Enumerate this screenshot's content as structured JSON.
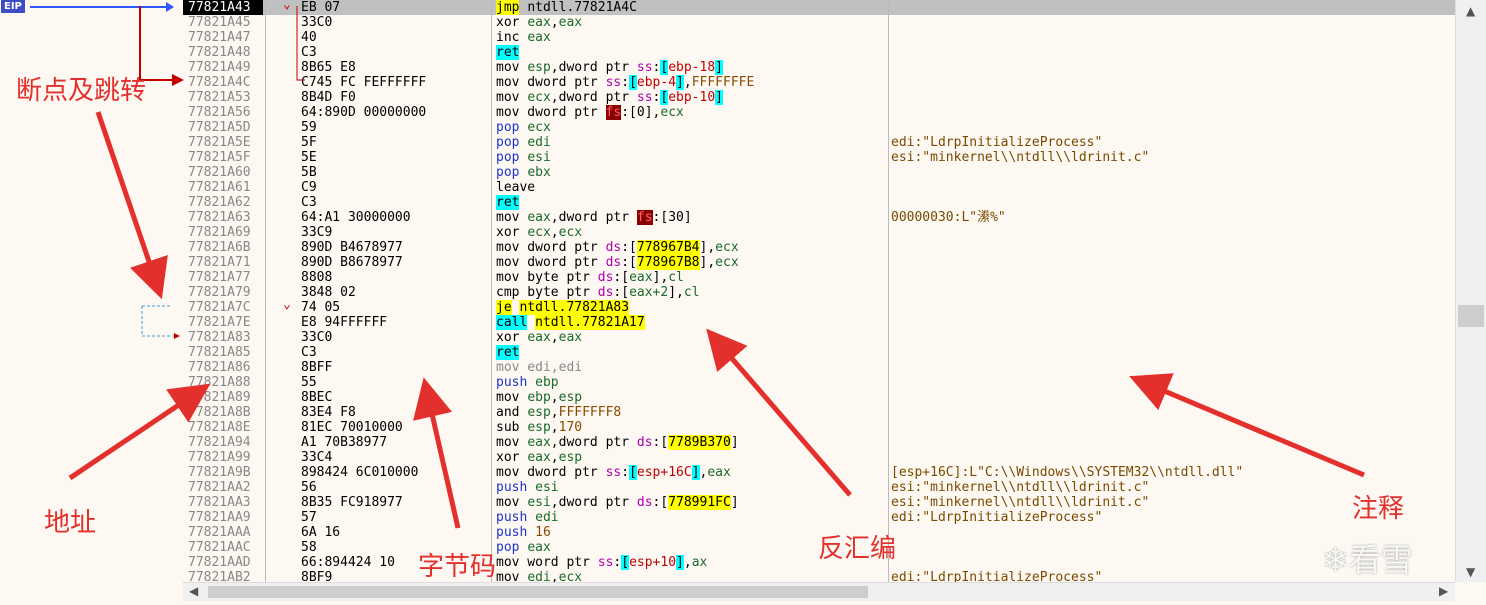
{
  "eip_label": "EIP",
  "colors": {
    "accent": "#3d4dc4",
    "annotation": "#e3302d",
    "highlight_yellow": "#ffff00",
    "highlight_cyan": "#00ffff"
  },
  "rows": [
    {
      "addr": "77821A43",
      "bytes": "EB 07",
      "asm": [
        [
          "jmp",
          "hl-y"
        ],
        [
          " ",
          ""
        ],
        [
          "ntdll.7782",
          ""
        ],
        [
          "1A4C",
          ""
        ]
      ],
      "cmt": "",
      "sel": true,
      "jmp": "v"
    },
    {
      "addr": "77821A45",
      "bytes": "33C0",
      "asm": [
        [
          "xor",
          ""
        ],
        [
          " ",
          ""
        ],
        [
          "eax",
          "reg"
        ],
        [
          ",",
          ""
        ],
        [
          "eax",
          "reg"
        ]
      ],
      "cmt": ""
    },
    {
      "addr": "77821A47",
      "bytes": "40",
      "asm": [
        [
          "inc",
          ""
        ],
        [
          " ",
          ""
        ],
        [
          "eax",
          "reg"
        ]
      ],
      "cmt": ""
    },
    {
      "addr": "77821A48",
      "bytes": "C3",
      "asm": [
        [
          "ret",
          "hl-c"
        ]
      ],
      "cmt": ""
    },
    {
      "addr": "77821A49",
      "bytes": "8B65 E8",
      "asm": [
        [
          "mov",
          ""
        ],
        [
          " ",
          ""
        ],
        [
          "esp",
          "reg"
        ],
        [
          ",dword ptr ",
          ""
        ],
        [
          "ss",
          "seg"
        ],
        [
          ":",
          ""
        ],
        [
          "[",
          "hl-c"
        ],
        [
          "ebp-18",
          "red"
        ],
        [
          "]",
          "hl-c"
        ]
      ],
      "cmt": ""
    },
    {
      "addr": "77821A4C",
      "bytes": "C745 FC FEFFFFFF",
      "asm": [
        [
          "mov",
          ""
        ],
        [
          " dword ptr ",
          ""
        ],
        [
          "ss",
          "seg"
        ],
        [
          ":",
          ""
        ],
        [
          "[",
          "hl-c"
        ],
        [
          "ebp-4",
          "red"
        ],
        [
          "]",
          "hl-c"
        ],
        [
          ",",
          ""
        ],
        [
          "FFFFFFFE",
          "num"
        ]
      ],
      "cmt": ""
    },
    {
      "addr": "77821A53",
      "bytes": "8B4D F0",
      "asm": [
        [
          "mov",
          ""
        ],
        [
          " ",
          ""
        ],
        [
          "ecx",
          "reg"
        ],
        [
          ",dword ptr ",
          ""
        ],
        [
          "ss",
          "seg"
        ],
        [
          ":",
          ""
        ],
        [
          "[",
          "hl-c"
        ],
        [
          "ebp-10",
          "red"
        ],
        [
          "]",
          "hl-c"
        ]
      ],
      "cmt": ""
    },
    {
      "addr": "77821A56",
      "bytes": "64:890D 00000000",
      "asm": [
        [
          "mov",
          ""
        ],
        [
          " dword ptr ",
          ""
        ],
        [
          "fs",
          "hl-r"
        ],
        [
          ":[0],",
          ""
        ],
        [
          "ecx",
          "reg"
        ]
      ],
      "cmt": ""
    },
    {
      "addr": "77821A5D",
      "bytes": "59",
      "asm": [
        [
          "pop",
          "k-blue"
        ],
        [
          " ",
          ""
        ],
        [
          "ecx",
          "reg"
        ]
      ],
      "cmt": ""
    },
    {
      "addr": "77821A5E",
      "bytes": "5F",
      "asm": [
        [
          "pop",
          "k-blue"
        ],
        [
          " ",
          ""
        ],
        [
          "edi",
          "reg"
        ]
      ],
      "cmt": "edi:\"LdrpInitializeProcess\""
    },
    {
      "addr": "77821A5F",
      "bytes": "5E",
      "asm": [
        [
          "pop",
          "k-blue"
        ],
        [
          " ",
          ""
        ],
        [
          "esi",
          "reg"
        ]
      ],
      "cmt": "esi:\"minkernel\\\\ntdll\\\\ldrinit.c\""
    },
    {
      "addr": "77821A60",
      "bytes": "5B",
      "asm": [
        [
          "pop",
          "k-blue"
        ],
        [
          " ",
          ""
        ],
        [
          "ebx",
          "reg"
        ]
      ],
      "cmt": ""
    },
    {
      "addr": "77821A61",
      "bytes": "C9",
      "asm": [
        [
          "leave",
          ""
        ]
      ],
      "cmt": ""
    },
    {
      "addr": "77821A62",
      "bytes": "C3",
      "asm": [
        [
          "ret",
          "hl-c"
        ]
      ],
      "cmt": ""
    },
    {
      "addr": "77821A63",
      "bytes": "64:A1 30000000",
      "asm": [
        [
          "mov",
          ""
        ],
        [
          " ",
          ""
        ],
        [
          "eax",
          "reg"
        ],
        [
          ",dword ptr ",
          ""
        ],
        [
          "fs",
          "hl-r"
        ],
        [
          ":[30]",
          ""
        ]
      ],
      "cmt": "00000030:L\"潫%\""
    },
    {
      "addr": "77821A69",
      "bytes": "33C9",
      "asm": [
        [
          "xor",
          ""
        ],
        [
          " ",
          ""
        ],
        [
          "ecx",
          "reg"
        ],
        [
          ",",
          ""
        ],
        [
          "ecx",
          "reg"
        ]
      ],
      "cmt": ""
    },
    {
      "addr": "77821A6B",
      "bytes": "890D B4678977",
      "asm": [
        [
          "mov",
          ""
        ],
        [
          " dword ptr ",
          ""
        ],
        [
          "ds",
          "seg"
        ],
        [
          ":[",
          ""
        ],
        [
          "778967B4",
          "hl-y"
        ],
        [
          "],",
          ""
        ],
        [
          "ecx",
          "reg"
        ]
      ],
      "cmt": ""
    },
    {
      "addr": "77821A71",
      "bytes": "890D B8678977",
      "asm": [
        [
          "mov",
          ""
        ],
        [
          " dword ptr ",
          ""
        ],
        [
          "ds",
          "seg"
        ],
        [
          ":[",
          ""
        ],
        [
          "778967B8",
          "hl-y"
        ],
        [
          "],",
          ""
        ],
        [
          "ecx",
          "reg"
        ]
      ],
      "cmt": ""
    },
    {
      "addr": "77821A77",
      "bytes": "8808",
      "asm": [
        [
          "mov",
          ""
        ],
        [
          " byte ptr ",
          ""
        ],
        [
          "ds",
          "seg"
        ],
        [
          ":[",
          ""
        ],
        [
          "eax",
          "reg"
        ],
        [
          "],",
          ""
        ],
        [
          "cl",
          "reg"
        ]
      ],
      "cmt": ""
    },
    {
      "addr": "77821A79",
      "bytes": "3848 02",
      "asm": [
        [
          "cmp",
          ""
        ],
        [
          " byte ptr ",
          ""
        ],
        [
          "ds",
          "seg"
        ],
        [
          ":[",
          ""
        ],
        [
          "eax+2",
          "reg"
        ],
        [
          "],",
          ""
        ],
        [
          "cl",
          "reg"
        ]
      ],
      "cmt": ""
    },
    {
      "addr": "77821A7C",
      "bytes": "74 05",
      "asm": [
        [
          "je",
          "hl-y"
        ],
        [
          " ",
          ""
        ],
        [
          "ntdll.77821A83",
          "hl-y"
        ]
      ],
      "cmt": "",
      "jmp": "v"
    },
    {
      "addr": "77821A7E",
      "bytes": "E8 94FFFFFF",
      "asm": [
        [
          "call",
          "hl-c"
        ],
        [
          " ",
          ""
        ],
        [
          "ntdll.77821A17",
          "hl-y"
        ]
      ],
      "cmt": ""
    },
    {
      "addr": "77821A83",
      "bytes": "33C0",
      "asm": [
        [
          "xor",
          ""
        ],
        [
          " ",
          ""
        ],
        [
          "eax",
          "reg"
        ],
        [
          ",",
          ""
        ],
        [
          "eax",
          "reg"
        ]
      ],
      "cmt": ""
    },
    {
      "addr": "77821A85",
      "bytes": "C3",
      "asm": [
        [
          "ret",
          "hl-c"
        ]
      ],
      "cmt": ""
    },
    {
      "addr": "77821A86",
      "bytes": "8BFF",
      "asm": [
        [
          "mov edi,edi",
          "k-gray"
        ]
      ],
      "cmt": ""
    },
    {
      "addr": "77821A88",
      "bytes": "55",
      "asm": [
        [
          "push",
          "k-blue"
        ],
        [
          " ",
          ""
        ],
        [
          "ebp",
          "reg"
        ]
      ],
      "cmt": ""
    },
    {
      "addr": "77821A89",
      "bytes": "8BEC",
      "asm": [
        [
          "mov",
          ""
        ],
        [
          " ",
          ""
        ],
        [
          "ebp",
          "reg"
        ],
        [
          ",",
          ""
        ],
        [
          "esp",
          "reg"
        ]
      ],
      "cmt": ""
    },
    {
      "addr": "77821A8B",
      "bytes": "83E4 F8",
      "asm": [
        [
          "and",
          ""
        ],
        [
          " ",
          ""
        ],
        [
          "esp",
          "reg"
        ],
        [
          ",",
          ""
        ],
        [
          "FFFFFFF8",
          "num"
        ]
      ],
      "cmt": ""
    },
    {
      "addr": "77821A8E",
      "bytes": "81EC 70010000",
      "asm": [
        [
          "sub",
          ""
        ],
        [
          " ",
          ""
        ],
        [
          "esp",
          "reg"
        ],
        [
          ",",
          ""
        ],
        [
          "170",
          "num"
        ]
      ],
      "cmt": ""
    },
    {
      "addr": "77821A94",
      "bytes": "A1 70B38977",
      "asm": [
        [
          "mov",
          ""
        ],
        [
          " ",
          ""
        ],
        [
          "eax",
          "reg"
        ],
        [
          ",dword ptr ",
          ""
        ],
        [
          "ds",
          "seg"
        ],
        [
          ":[",
          ""
        ],
        [
          "7789B370",
          "hl-y"
        ],
        [
          "]",
          ""
        ]
      ],
      "cmt": ""
    },
    {
      "addr": "77821A99",
      "bytes": "33C4",
      "asm": [
        [
          "xor",
          ""
        ],
        [
          " ",
          ""
        ],
        [
          "eax",
          "reg"
        ],
        [
          ",",
          ""
        ],
        [
          "esp",
          "reg"
        ]
      ],
      "cmt": ""
    },
    {
      "addr": "77821A9B",
      "bytes": "898424 6C010000",
      "asm": [
        [
          "mov",
          ""
        ],
        [
          " dword ptr ",
          ""
        ],
        [
          "ss",
          "seg"
        ],
        [
          ":",
          ""
        ],
        [
          "[",
          "hl-c"
        ],
        [
          "esp+16C",
          "red"
        ],
        [
          "]",
          "hl-c"
        ],
        [
          ",",
          ""
        ],
        [
          "eax",
          "reg"
        ]
      ],
      "cmt": "[esp+16C]:L\"C:\\\\Windows\\\\SYSTEM32\\\\ntdll.dll\""
    },
    {
      "addr": "77821AA2",
      "bytes": "56",
      "asm": [
        [
          "push",
          "k-blue"
        ],
        [
          " ",
          ""
        ],
        [
          "esi",
          "reg"
        ]
      ],
      "cmt": "esi:\"minkernel\\\\ntdll\\\\ldrinit.c\""
    },
    {
      "addr": "77821AA3",
      "bytes": "8B35 FC918977",
      "asm": [
        [
          "mov",
          ""
        ],
        [
          " ",
          ""
        ],
        [
          "esi",
          "reg"
        ],
        [
          ",dword ptr ",
          ""
        ],
        [
          "ds",
          "seg"
        ],
        [
          ":[",
          ""
        ],
        [
          "778991FC",
          "hl-y"
        ],
        [
          "]",
          ""
        ]
      ],
      "cmt": "esi:\"minkernel\\\\ntdll\\\\ldrinit.c\""
    },
    {
      "addr": "77821AA9",
      "bytes": "57",
      "asm": [
        [
          "push",
          "k-blue"
        ],
        [
          " ",
          ""
        ],
        [
          "edi",
          "reg"
        ]
      ],
      "cmt": "edi:\"LdrpInitializeProcess\""
    },
    {
      "addr": "77821AAA",
      "bytes": "6A 16",
      "asm": [
        [
          "push",
          "k-blue"
        ],
        [
          " ",
          ""
        ],
        [
          "16",
          "num"
        ]
      ],
      "cmt": ""
    },
    {
      "addr": "77821AAC",
      "bytes": "58",
      "asm": [
        [
          "pop",
          "k-blue"
        ],
        [
          " ",
          ""
        ],
        [
          "eax",
          "reg"
        ]
      ],
      "cmt": ""
    },
    {
      "addr": "77821AAD",
      "bytes": "66:894424 10",
      "asm": [
        [
          "mov",
          ""
        ],
        [
          " word ptr ",
          ""
        ],
        [
          "ss",
          "seg"
        ],
        [
          ":",
          ""
        ],
        [
          "[",
          "hl-c"
        ],
        [
          "esp+10",
          "red"
        ],
        [
          "]",
          "hl-c"
        ],
        [
          ",",
          ""
        ],
        [
          "ax",
          "reg"
        ]
      ],
      "cmt": ""
    },
    {
      "addr": "77821AB2",
      "bytes": "8BF9",
      "asm": [
        [
          "mov",
          ""
        ],
        [
          " ",
          ""
        ],
        [
          "edi",
          "reg"
        ],
        [
          ",",
          ""
        ],
        [
          "ecx",
          "reg"
        ]
      ],
      "cmt": "edi:\"LdrpInitializeProcess\""
    }
  ],
  "annotations": {
    "breakpoint_jump": "断点及跳转",
    "address": "地址",
    "bytecode": "字节码",
    "disassembly": "反汇编",
    "comment": "注释"
  },
  "watermark": "看雪"
}
